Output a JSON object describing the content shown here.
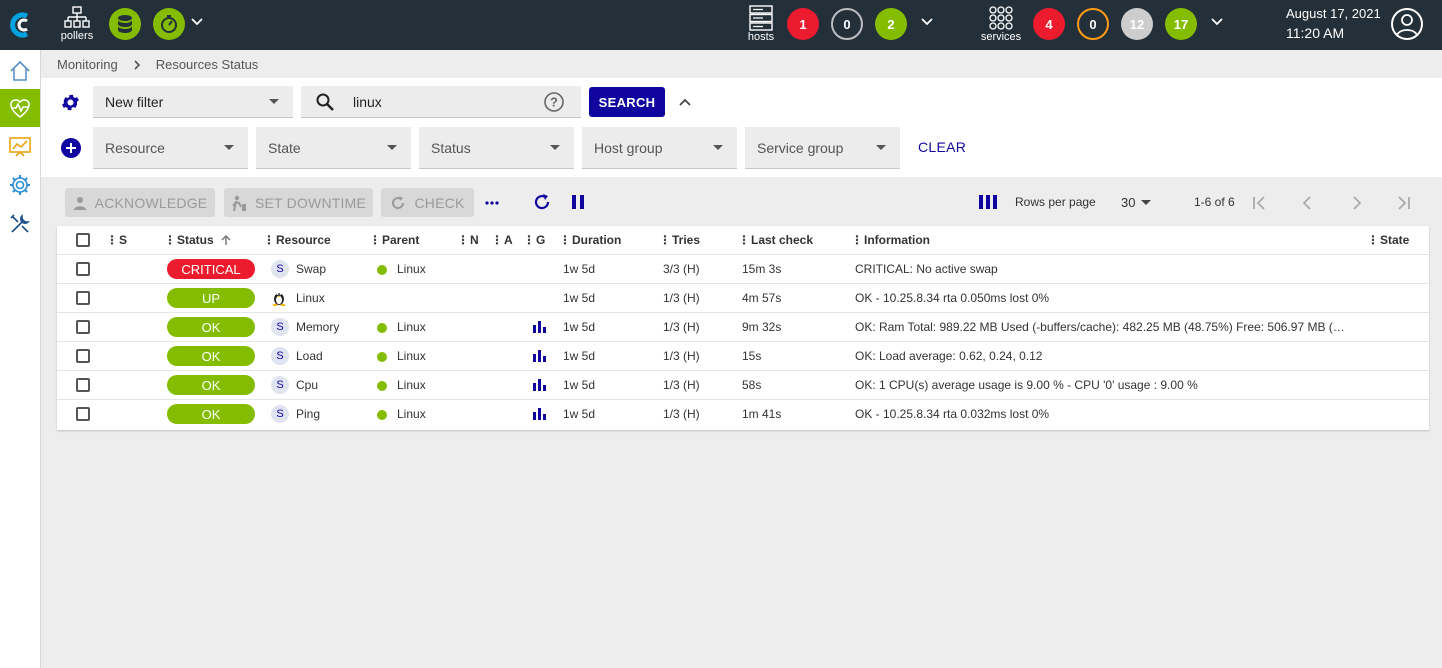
{
  "topbar": {
    "pollers_label": "pollers",
    "hosts_label": "hosts",
    "services_label": "services",
    "hosts_counts": [
      {
        "value": "1",
        "kind": "down",
        "color": "#ed1b2e"
      },
      {
        "value": "0",
        "kind": "unreachable",
        "color": "#bcbdc0"
      },
      {
        "value": "2",
        "kind": "up",
        "color": "#84bd00"
      }
    ],
    "services_counts": [
      {
        "value": "4",
        "kind": "critical",
        "color": "#ed1b2e"
      },
      {
        "value": "0",
        "kind": "warning",
        "color": "#ff9a13"
      },
      {
        "value": "12",
        "kind": "unknown",
        "color": "#cdcdcd"
      },
      {
        "value": "17",
        "kind": "ok",
        "color": "#84bd00"
      }
    ],
    "date": "August 17, 2021",
    "time": "11:20 AM"
  },
  "sidebar": {
    "items": [
      {
        "name": "home-icon",
        "active": false
      },
      {
        "name": "monitoring-icon",
        "active": true
      },
      {
        "name": "reporting-icon",
        "active": false
      },
      {
        "name": "configuration-icon",
        "active": false
      },
      {
        "name": "administration-icon",
        "active": false
      }
    ]
  },
  "breadcrumb": {
    "items": [
      "Monitoring",
      "Resources Status"
    ]
  },
  "filter": {
    "selected": "New filter",
    "search_value": "linux",
    "search_button": "SEARCH",
    "criteria": [
      "Resource",
      "State",
      "Status",
      "Host group",
      "Service group"
    ],
    "clear_button": "CLEAR"
  },
  "actions": {
    "acknowledge": "ACKNOWLEDGE",
    "set_downtime": "SET DOWNTIME",
    "check": "CHECK",
    "rows_per_page_label": "Rows per page",
    "rows_per_page_value": "30",
    "page_info": "1-6 of 6"
  },
  "table": {
    "headers": {
      "s": "S",
      "status": "Status",
      "resource": "Resource",
      "parent": "Parent",
      "n": "N",
      "a": "A",
      "g": "G",
      "duration": "Duration",
      "tries": "Tries",
      "last_check": "Last check",
      "information": "Information",
      "state": "State"
    },
    "rows": [
      {
        "status": "CRITICAL",
        "status_color": "#ed1b2e",
        "resource_type": "S",
        "resource": "Swap",
        "parent": "Linux",
        "graph": false,
        "duration": "1w 5d",
        "tries": "3/3 (H)",
        "last_check": "15m 3s",
        "information": "CRITICAL: No active swap"
      },
      {
        "status": "UP",
        "status_color": "#84bd00",
        "resource_type": "linux-icon",
        "resource": "Linux",
        "parent": "",
        "graph": false,
        "duration": "1w 5d",
        "tries": "1/3 (H)",
        "last_check": "4m 57s",
        "information": "OK - 10.25.8.34 rta 0.050ms lost 0%"
      },
      {
        "status": "OK",
        "status_color": "#84bd00",
        "resource_type": "S",
        "resource": "Memory",
        "parent": "Linux",
        "graph": true,
        "duration": "1w 5d",
        "tries": "1/3 (H)",
        "last_check": "9m 32s",
        "information": "OK: Ram Total: 989.22 MB Used (-buffers/cache): 482.25 MB (48.75%) Free: 506.97 MB (…"
      },
      {
        "status": "OK",
        "status_color": "#84bd00",
        "resource_type": "S",
        "resource": "Load",
        "parent": "Linux",
        "graph": true,
        "duration": "1w 5d",
        "tries": "1/3 (H)",
        "last_check": "15s",
        "information": "OK: Load average: 0.62, 0.24, 0.12"
      },
      {
        "status": "OK",
        "status_color": "#84bd00",
        "resource_type": "S",
        "resource": "Cpu",
        "parent": "Linux",
        "graph": true,
        "duration": "1w 5d",
        "tries": "1/3 (H)",
        "last_check": "58s",
        "information": "OK: 1 CPU(s) average usage is 9.00 % - CPU '0' usage : 9.00 %"
      },
      {
        "status": "OK",
        "status_color": "#84bd00",
        "resource_type": "S",
        "resource": "Ping",
        "parent": "Linux",
        "graph": true,
        "duration": "1w 5d",
        "tries": "1/3 (H)",
        "last_check": "1m 41s",
        "information": "OK - 10.25.8.34 rta 0.032ms lost 0%"
      }
    ]
  }
}
